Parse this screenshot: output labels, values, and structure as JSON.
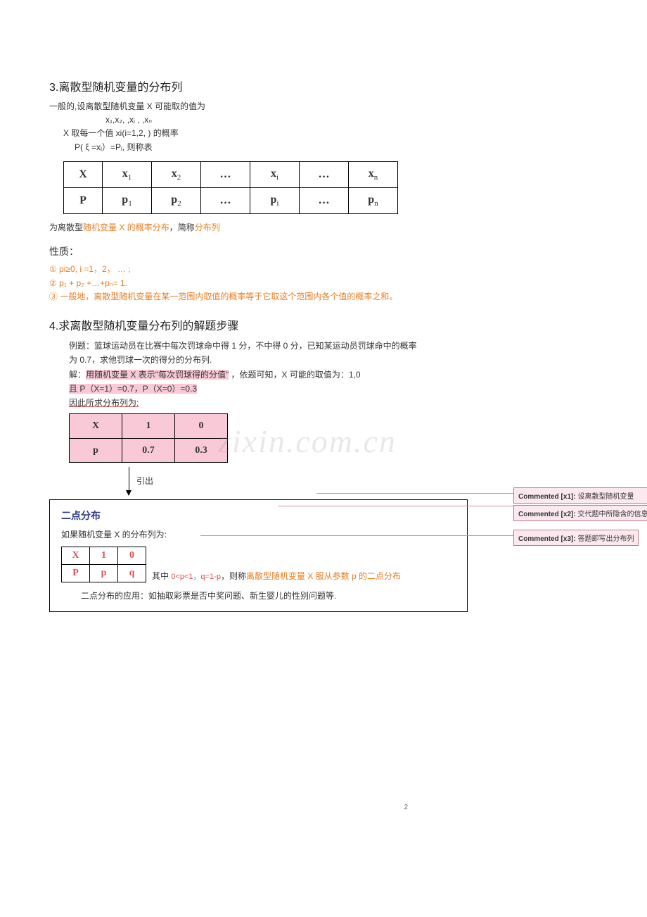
{
  "heading3": "3.离散型随机变量的分布列",
  "p3a": "一般的,设离散型随机变量 X 可能取的值为",
  "p3_vals": "x₁,x₂,    ,xᵢ ,     ,xₙ",
  "p3b": "X 取每一个值  xi(i=1,2,      ) 的概率",
  "p3c": "P( ξ =xᵢ）=Pᵢ,  则称表",
  "dist_table": {
    "r1": [
      "X",
      "x₁",
      "x₂",
      "…",
      "xᵢ",
      "…",
      "xₙ"
    ],
    "r2": [
      "P",
      "p₁",
      "p₂",
      "…",
      "pᵢ",
      "…",
      "pₙ"
    ]
  },
  "p3d_pre": "为离散型",
  "p3d_mid": "随机变量 X  的概率分布",
  "p3d_post": "，简称",
  "p3d_end": "分布列",
  "props_h": "性质：",
  "prop1": "①  pi≥0, i =1，2， …    ;",
  "prop2": "②  p₁ + p₂ +…+pₙ= 1.",
  "prop3": "③ 一般地，离散型随机变量在某一范围内取值的概率等于它取这个范围内各个值的概率之和。",
  "heading4": "4.求离散型随机变量分布列的解题步骤",
  "ex_line1": "例题：篮球运动员在比赛中每次罚球命中得 1 分，不中得 0 分，已知某运动员罚球命中的概率",
  "ex_line2": "为 0.7，求他罚球一次的得分的分布列.",
  "sol_pre": "解：",
  "sol_hl1": "用随机变量 X 表示\"每次罚球得的分值\"",
  "sol_mid": " ，依题可知，X 可能的取值为：1,0",
  "sol_hl2": "且 P（X=1）=0.7，P（X=0）=0.3",
  "sol_line3": "因此所求分布列为:",
  "sol_table": {
    "r1": [
      "X",
      "1",
      "0"
    ],
    "r2": [
      "p",
      "0.7",
      "0.3"
    ]
  },
  "arrow_label": "引出",
  "box_title": "二点分布",
  "box_p1": "如果随机变量 X 的分布列为:",
  "mini_table": {
    "r1": [
      "X",
      "1",
      "0"
    ],
    "r2": [
      "P",
      "p",
      "q"
    ]
  },
  "box_p2a": "其中 ",
  "box_p2b": "0<p<1，q=1-p",
  "box_p2c": "，则称",
  "box_p2d": "离散型随机变量 X 服从参数 p 的二点分布",
  "box_p3": "二点分布的应用：如抽取彩票是否中奖问题、新生婴儿的性别问题等.",
  "page_num": "2",
  "watermark": "zixin.com.cn",
  "comments": [
    {
      "label": "Commented [x1]:",
      "text": " 设离散型随机变量"
    },
    {
      "label": "Commented [x2]:",
      "text": " 交代题中所隐含的信息"
    },
    {
      "label": "Commented [x3]:",
      "text": " 答题即写出分布列"
    }
  ]
}
